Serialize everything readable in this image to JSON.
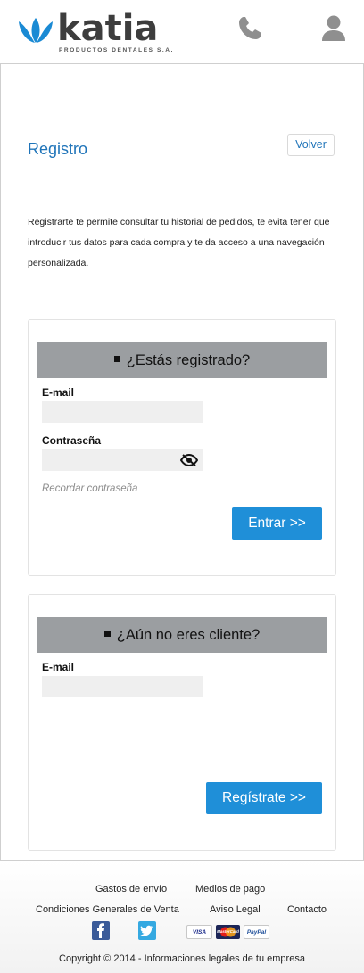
{
  "header": {
    "brand_name": "katia",
    "brand_tagline": "PRODUCTOS DENTALES S.A.",
    "phone_icon": "phone-icon",
    "user_icon": "user-icon"
  },
  "page": {
    "title": "Registro",
    "back_label": "Volver",
    "intro": "Registrarte te permite consultar tu historial de pedidos, te evita tener que introducir tus datos para cada compra y te da acceso a una navegación personalizada."
  },
  "login": {
    "heading": "¿Estás registrado?",
    "email_label": "E-mail",
    "email_value": "",
    "password_label": "Contraseña",
    "password_value": "",
    "show_password_icon": "eye-slash-icon",
    "forgot_label": "Recordar contraseña",
    "submit_label": "Entrar >>"
  },
  "register": {
    "heading": "¿Aún no eres cliente?",
    "email_label": "E-mail",
    "email_value": "",
    "submit_label": "Regístrate >>"
  },
  "footer": {
    "links": [
      "Gastos de envío",
      "Medios de pago",
      "Condiciones Generales de Venta",
      "Aviso Legal",
      "Contacto"
    ],
    "social": [
      "facebook-icon",
      "twitter-icon"
    ],
    "payments": [
      "VISA",
      "MasterCard",
      "PayPal"
    ],
    "copyright": "Copyright © 2014 - Informaciones legales de tu empresa"
  },
  "colors": {
    "accent": "#1f74b9",
    "button": "#1f8fd8",
    "panel_header": "#9b9ea1",
    "input_bg": "#efefef"
  }
}
